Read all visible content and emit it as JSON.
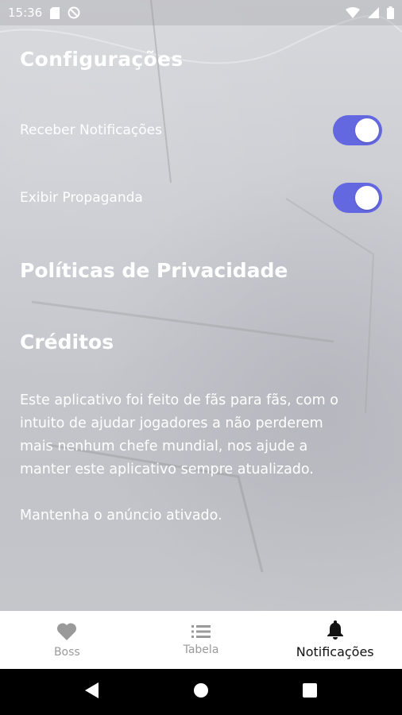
{
  "status_bar": {
    "time": "15:36",
    "icons_left": [
      "sd-card-icon",
      "do-not-disturb-icon"
    ],
    "icons_right": [
      "wifi-icon",
      "signal-icon",
      "battery-icon"
    ]
  },
  "settings": {
    "title": "Configurações",
    "toggles": [
      {
        "label": "Receber Notificações",
        "on": true
      },
      {
        "label": "Exibir Propaganda",
        "on": true
      }
    ]
  },
  "privacy": {
    "title": "Políticas de Privacidade"
  },
  "credits": {
    "title": "Créditos",
    "body_lines": [
      "Este aplicativo foi feito de fãs para fãs, com o",
      "intuito de ajudar jogadores a não perderem",
      "mais nenhum chefe mundial, nos ajude a",
      "manter este aplicativo sempre atualizado."
    ],
    "note": "Mantenha o anúncio ativado."
  },
  "bottom_nav": {
    "items": [
      {
        "label": "Boss",
        "icon": "heart-icon",
        "active": false
      },
      {
        "label": "Tabela",
        "icon": "list-icon",
        "active": false
      },
      {
        "label": "Notificações",
        "icon": "bell-icon",
        "active": true
      }
    ]
  },
  "colors": {
    "toggle_on": "#6468e0",
    "active_nav": "#111111",
    "inactive_nav": "#9a9a9a"
  }
}
